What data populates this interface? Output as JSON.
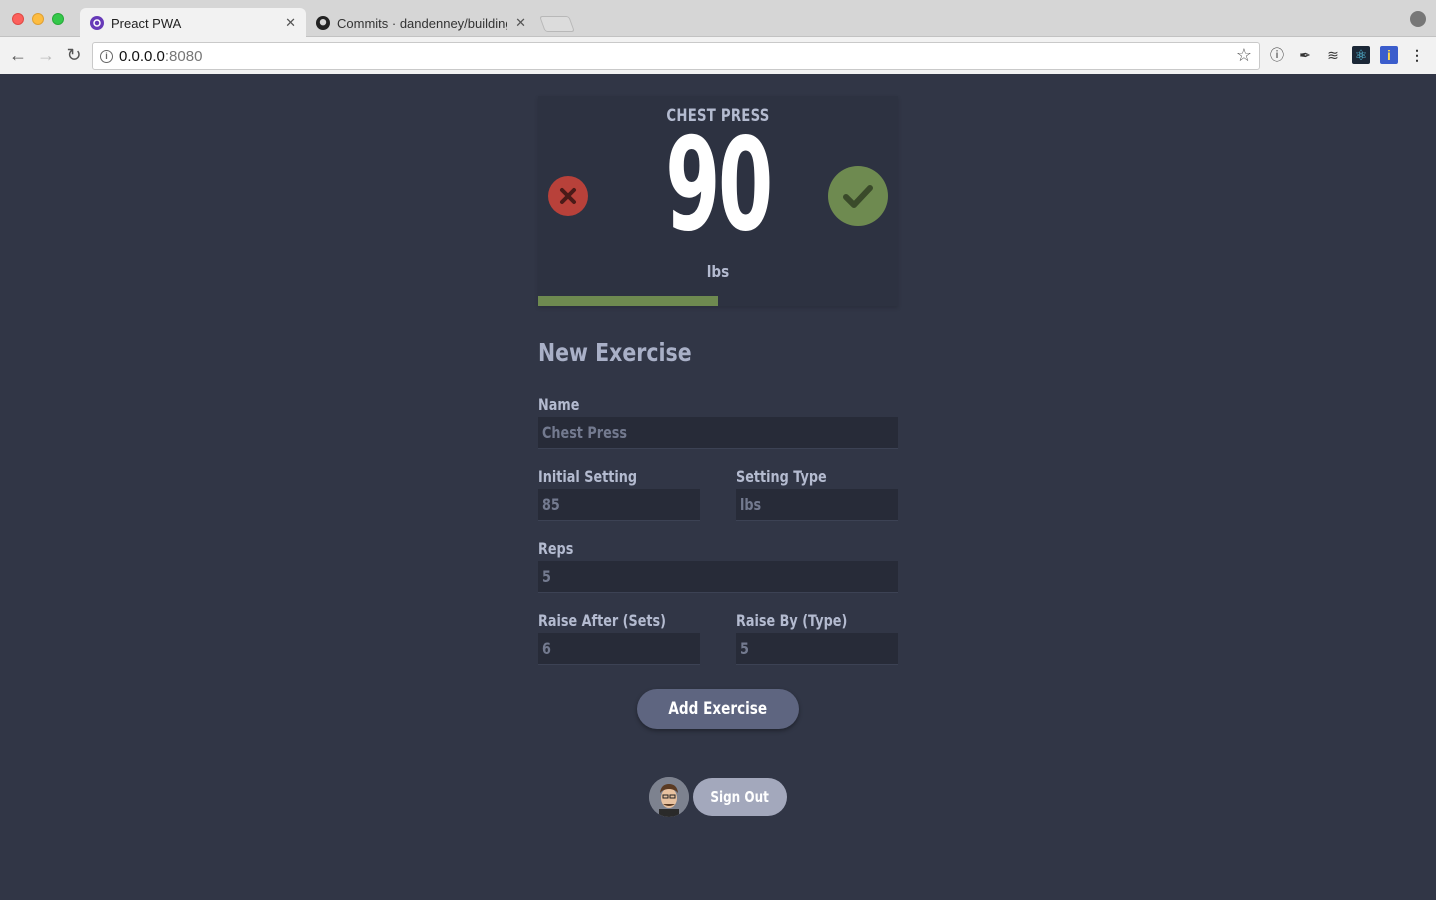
{
  "browser": {
    "tabs": [
      {
        "title": "Preact PWA",
        "active": true
      },
      {
        "title": "Commits · dandenney/building",
        "active": false
      }
    ],
    "url_host": "0.0.0.0",
    "url_port": ":8080"
  },
  "current": {
    "exercise_name": "CHEST PRESS",
    "weight": "90",
    "unit": "lbs",
    "progress_fraction": 0.5,
    "fail_icon": "close-icon",
    "success_icon": "check-icon"
  },
  "form": {
    "title": "New Exercise",
    "name_label": "Name",
    "name_placeholder": "Chest Press",
    "initial_setting_label": "Initial Setting",
    "initial_setting_placeholder": "85",
    "setting_type_label": "Setting Type",
    "setting_type_placeholder": "lbs",
    "reps_label": "Reps",
    "reps_placeholder": "5",
    "raise_after_label": "Raise After (Sets)",
    "raise_after_placeholder": "6",
    "raise_by_label": "Raise By (Type)",
    "raise_by_placeholder": "5",
    "submit_label": "Add Exercise"
  },
  "user": {
    "signout_label": "Sign Out"
  },
  "colors": {
    "background": "#313646",
    "fail": "#b8413a",
    "success": "#6e8a50",
    "button": "#5e6580"
  }
}
